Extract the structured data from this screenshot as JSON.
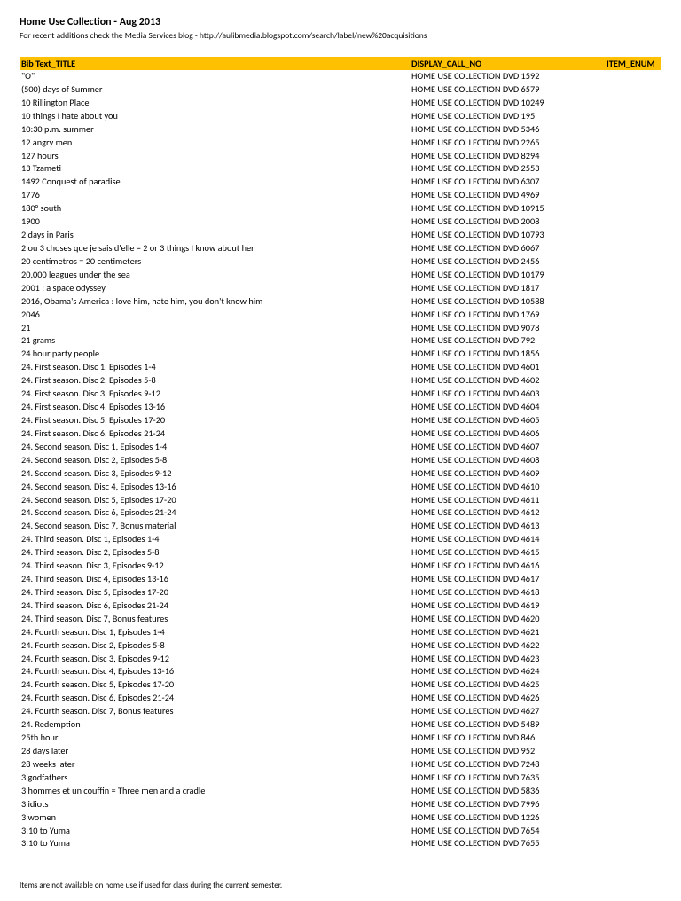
{
  "header": {
    "title": "Home Use Collection - Aug 2013",
    "subtitle": "For recent additions check the Media Services blog - http://aulibmedia.blogspot.com/search/label/new%20acquisitions"
  },
  "columns": {
    "title": "Bib Text_TITLE",
    "callno": "DISPLAY_CALL_NO",
    "enum": "ITEM_ENUM"
  },
  "rows": [
    {
      "title": "\"O\"",
      "callno": "HOME USE COLLECTION DVD 1592",
      "enum": ""
    },
    {
      "title": "(500) days of Summer",
      "callno": "HOME USE COLLECTION DVD 6579",
      "enum": ""
    },
    {
      "title": "10 Rillington Place",
      "callno": "HOME USE COLLECTION DVD 10249",
      "enum": ""
    },
    {
      "title": "10 things I hate about you",
      "callno": "HOME USE COLLECTION DVD 195",
      "enum": ""
    },
    {
      "title": "10:30 p.m. summer",
      "callno": "HOME USE COLLECTION DVD 5346",
      "enum": ""
    },
    {
      "title": "12 angry men",
      "callno": "HOME USE COLLECTION DVD 2265",
      "enum": ""
    },
    {
      "title": "127 hours",
      "callno": "HOME USE COLLECTION DVD 8294",
      "enum": ""
    },
    {
      "title": "13 Tzameti",
      "callno": "HOME USE COLLECTION DVD 2553",
      "enum": ""
    },
    {
      "title": "1492  Conquest of paradise",
      "callno": "HOME USE COLLECTION DVD 6307",
      "enum": ""
    },
    {
      "title": "1776",
      "callno": "HOME USE COLLECTION DVD 4969",
      "enum": ""
    },
    {
      "title": "180° south",
      "callno": "HOME USE COLLECTION DVD 10915",
      "enum": ""
    },
    {
      "title": "1900",
      "callno": "HOME USE COLLECTION DVD 2008",
      "enum": ""
    },
    {
      "title": "2 days in Paris",
      "callno": "HOME USE COLLECTION DVD 10793",
      "enum": ""
    },
    {
      "title": "2 ou 3 choses que je sais d'elle = 2 or 3 things I know about her",
      "callno": "HOME USE COLLECTION DVD 6067",
      "enum": ""
    },
    {
      "title": "20 centímetros = 20 centimeters",
      "callno": "HOME USE COLLECTION DVD 2456",
      "enum": ""
    },
    {
      "title": "20,000 leagues under the sea",
      "callno": "HOME USE COLLECTION DVD 10179",
      "enum": ""
    },
    {
      "title": "2001  : a space odyssey",
      "callno": "HOME USE COLLECTION DVD 1817",
      "enum": ""
    },
    {
      "title": "2016, Obama's America  : love him, hate him, you don't know him",
      "callno": "HOME USE COLLECTION DVD 10588",
      "enum": ""
    },
    {
      "title": "2046",
      "callno": "HOME USE COLLECTION DVD 1769",
      "enum": ""
    },
    {
      "title": "21",
      "callno": "HOME USE COLLECTION DVD 9078",
      "enum": ""
    },
    {
      "title": "21 grams",
      "callno": "HOME USE COLLECTION DVD 792",
      "enum": ""
    },
    {
      "title": "24 hour party people",
      "callno": "HOME USE COLLECTION DVD 1856",
      "enum": ""
    },
    {
      "title": "24. First season. Disc 1, Episodes 1-4",
      "callno": "HOME USE COLLECTION DVD 4601",
      "enum": ""
    },
    {
      "title": "24. First season. Disc 2, Episodes 5-8",
      "callno": "HOME USE COLLECTION DVD 4602",
      "enum": ""
    },
    {
      "title": "24. First season. Disc 3, Episodes 9-12",
      "callno": "HOME USE COLLECTION DVD 4603",
      "enum": ""
    },
    {
      "title": "24. First season. Disc 4, Episodes 13-16",
      "callno": "HOME USE COLLECTION DVD 4604",
      "enum": ""
    },
    {
      "title": "24. First season. Disc 5, Episodes 17-20",
      "callno": "HOME USE COLLECTION DVD 4605",
      "enum": ""
    },
    {
      "title": "24. First season. Disc 6, Episodes 21-24",
      "callno": "HOME USE COLLECTION DVD 4606",
      "enum": ""
    },
    {
      "title": "24. Second season. Disc 1, Episodes 1-4",
      "callno": "HOME USE COLLECTION DVD 4607",
      "enum": ""
    },
    {
      "title": "24. Second season. Disc 2, Episodes 5-8",
      "callno": "HOME USE COLLECTION DVD 4608",
      "enum": ""
    },
    {
      "title": "24. Second season. Disc 3, Episodes 9-12",
      "callno": "HOME USE COLLECTION DVD 4609",
      "enum": ""
    },
    {
      "title": "24. Second season. Disc 4, Episodes 13-16",
      "callno": "HOME USE COLLECTION DVD 4610",
      "enum": ""
    },
    {
      "title": "24. Second season. Disc 5, Episodes 17-20",
      "callno": "HOME USE COLLECTION DVD 4611",
      "enum": ""
    },
    {
      "title": "24. Second season. Disc 6, Episodes 21-24",
      "callno": "HOME USE COLLECTION DVD 4612",
      "enum": ""
    },
    {
      "title": "24. Second season. Disc 7, Bonus material",
      "callno": "HOME USE COLLECTION DVD 4613",
      "enum": ""
    },
    {
      "title": "24. Third season. Disc 1, Episodes 1-4",
      "callno": "HOME USE COLLECTION DVD 4614",
      "enum": ""
    },
    {
      "title": "24. Third season. Disc 2, Episodes 5-8",
      "callno": "HOME USE COLLECTION DVD 4615",
      "enum": ""
    },
    {
      "title": "24. Third season. Disc 3, Episodes 9-12",
      "callno": "HOME USE COLLECTION DVD 4616",
      "enum": ""
    },
    {
      "title": "24. Third season. Disc 4, Episodes 13-16",
      "callno": "HOME USE COLLECTION DVD 4617",
      "enum": ""
    },
    {
      "title": "24. Third season. Disc 5, Episodes 17-20",
      "callno": "HOME USE COLLECTION DVD 4618",
      "enum": ""
    },
    {
      "title": "24. Third season. Disc 6, Episodes 21-24",
      "callno": "HOME USE COLLECTION DVD 4619",
      "enum": ""
    },
    {
      "title": "24. Third season. Disc 7, Bonus features",
      "callno": "HOME USE COLLECTION DVD 4620",
      "enum": ""
    },
    {
      "title": "24. Fourth season. Disc 1, Episodes 1-4",
      "callno": "HOME USE COLLECTION DVD 4621",
      "enum": ""
    },
    {
      "title": "24. Fourth season. Disc 2, Episodes 5-8",
      "callno": "HOME USE COLLECTION DVD 4622",
      "enum": ""
    },
    {
      "title": "24. Fourth season. Disc 3, Episodes 9-12",
      "callno": "HOME USE COLLECTION DVD 4623",
      "enum": ""
    },
    {
      "title": "24. Fourth season. Disc 4, Episodes 13-16",
      "callno": "HOME USE COLLECTION DVD 4624",
      "enum": ""
    },
    {
      "title": "24. Fourth season. Disc 5, Episodes 17-20",
      "callno": "HOME USE COLLECTION DVD 4625",
      "enum": ""
    },
    {
      "title": "24. Fourth season. Disc 6, Episodes 21-24",
      "callno": "HOME USE COLLECTION DVD 4626",
      "enum": ""
    },
    {
      "title": "24. Fourth season. Disc 7, Bonus features",
      "callno": "HOME USE COLLECTION DVD 4627",
      "enum": ""
    },
    {
      "title": "24. Redemption",
      "callno": "HOME USE COLLECTION DVD 5489",
      "enum": ""
    },
    {
      "title": "25th hour",
      "callno": "HOME USE COLLECTION DVD 846",
      "enum": ""
    },
    {
      "title": "28 days later",
      "callno": "HOME USE COLLECTION DVD 952",
      "enum": ""
    },
    {
      "title": "28 weeks later",
      "callno": "HOME USE COLLECTION DVD 7248",
      "enum": ""
    },
    {
      "title": "3 godfathers",
      "callno": "HOME USE COLLECTION DVD 7635",
      "enum": ""
    },
    {
      "title": "3 hommes et un couffin = Three men and a cradle",
      "callno": "HOME USE COLLECTION DVD 5836",
      "enum": ""
    },
    {
      "title": "3 idiots",
      "callno": "HOME USE COLLECTION DVD 7996",
      "enum": ""
    },
    {
      "title": "3 women",
      "callno": "HOME USE COLLECTION DVD 1226",
      "enum": ""
    },
    {
      "title": "3:10 to Yuma",
      "callno": "HOME USE COLLECTION DVD 7654",
      "enum": ""
    },
    {
      "title": "3:10 to Yuma",
      "callno": "HOME USE COLLECTION DVD 7655",
      "enum": ""
    }
  ],
  "footer": {
    "note": "Items are not available on home use if used for class during the current semester."
  }
}
